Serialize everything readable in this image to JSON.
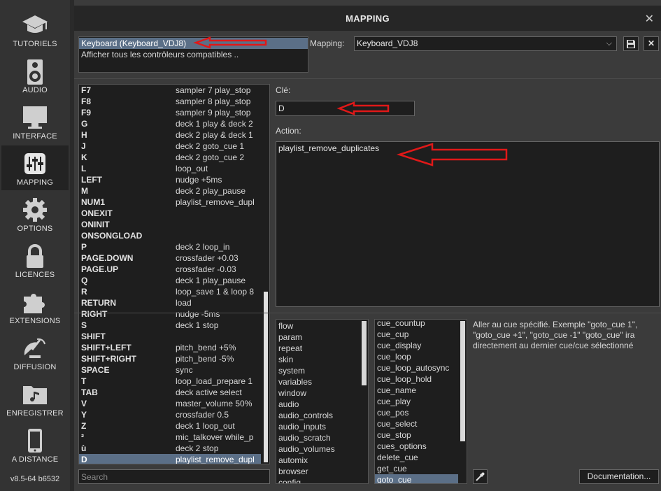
{
  "sidebar": {
    "items": [
      {
        "label": "TUTORIELS",
        "icon": "graduation-cap-icon"
      },
      {
        "label": "AUDIO",
        "icon": "speaker-icon"
      },
      {
        "label": "INTERFACE",
        "icon": "monitor-icon"
      },
      {
        "label": "MAPPING",
        "icon": "sliders-icon",
        "active": true
      },
      {
        "label": "OPTIONS",
        "icon": "gear-icon"
      },
      {
        "label": "LICENCES",
        "icon": "lock-icon"
      },
      {
        "label": "EXTENSIONS",
        "icon": "puzzle-icon"
      },
      {
        "label": "DIFFUSION",
        "icon": "broadcast-icon"
      },
      {
        "label": "ENREGISTRER",
        "icon": "music-folder-icon"
      },
      {
        "label": "A DISTANCE",
        "icon": "tablet-icon"
      }
    ],
    "version": "v8.5-64 b6532"
  },
  "dialog": {
    "title": "MAPPING",
    "close_icon": "close-icon"
  },
  "devices": {
    "items": [
      {
        "label": "Keyboard (Keyboard_VDJ8)",
        "selected": true
      },
      {
        "label": "Afficher tous les contrôleurs compatibles ..",
        "selected": false
      }
    ]
  },
  "mapping": {
    "label": "Mapping:",
    "value": "Keyboard_VDJ8",
    "save_icon": "floppy-disk-icon",
    "delete_label": "✕"
  },
  "keylist": {
    "rows": [
      {
        "key": "F7",
        "action": "sampler 7 play_stop"
      },
      {
        "key": "F8",
        "action": "sampler 8 play_stop"
      },
      {
        "key": "F9",
        "action": "sampler 9 play_stop"
      },
      {
        "key": "G",
        "action": "deck 1 play & deck 2"
      },
      {
        "key": "H",
        "action": "deck 2 play & deck 1"
      },
      {
        "key": "J",
        "action": "deck 2 goto_cue 1"
      },
      {
        "key": "K",
        "action": "deck 2 goto_cue 2"
      },
      {
        "key": "L",
        "action": "loop_out"
      },
      {
        "key": "LEFT",
        "action": "nudge +5ms"
      },
      {
        "key": "M",
        "action": "deck 2 play_pause"
      },
      {
        "key": "NUM1",
        "action": "playlist_remove_dupl"
      },
      {
        "key": "ONEXIT",
        "action": ""
      },
      {
        "key": "ONINIT",
        "action": ""
      },
      {
        "key": "ONSONGLOAD",
        "action": ""
      },
      {
        "key": "P",
        "action": "deck 2 loop_in"
      },
      {
        "key": "PAGE.DOWN",
        "action": "crossfader +0.03"
      },
      {
        "key": "PAGE.UP",
        "action": "crossfader -0.03"
      },
      {
        "key": "Q",
        "action": "deck 1 play_pause"
      },
      {
        "key": "R",
        "action": "loop_save 1 & loop 8"
      },
      {
        "key": "RETURN",
        "action": "load"
      },
      {
        "key": "RIGHT",
        "action": "nudge -5ms"
      },
      {
        "key": "S",
        "action": "deck 1 stop"
      },
      {
        "key": "SHIFT",
        "action": ""
      },
      {
        "key": "SHIFT+LEFT",
        "action": "pitch_bend +5%"
      },
      {
        "key": "SHIFT+RIGHT",
        "action": "pitch_bend -5%"
      },
      {
        "key": "SPACE",
        "action": "sync"
      },
      {
        "key": "T",
        "action": "loop_load_prepare 1"
      },
      {
        "key": "TAB",
        "action": "deck active select"
      },
      {
        "key": "V",
        "action": "master_volume 50%"
      },
      {
        "key": "Y",
        "action": "crossfader 0.5"
      },
      {
        "key": "Z",
        "action": "deck 1 loop_out"
      },
      {
        "key": "²",
        "action": "mic_talkover while_p"
      },
      {
        "key": "ù",
        "action": "deck 2 stop"
      },
      {
        "key": "D",
        "action": "playlist_remove_dupl",
        "selected": true
      }
    ]
  },
  "search": {
    "placeholder": "Search"
  },
  "key_editor": {
    "key_label": "Clé:",
    "key_value": "D",
    "action_label": "Action:",
    "action_value": "playlist_remove_duplicates"
  },
  "categories": [
    "flow",
    "param",
    "repeat",
    "skin",
    "system",
    "variables",
    "window",
    "audio",
    "audio_controls",
    "audio_inputs",
    "audio_scratch",
    "audio_volumes",
    "automix",
    "browser",
    "config"
  ],
  "verbs": [
    {
      "label": "cue_countup"
    },
    {
      "label": "cue_cup"
    },
    {
      "label": "cue_display"
    },
    {
      "label": "cue_loop"
    },
    {
      "label": "cue_loop_autosync"
    },
    {
      "label": "cue_loop_hold"
    },
    {
      "label": "cue_name"
    },
    {
      "label": "cue_play"
    },
    {
      "label": "cue_pos"
    },
    {
      "label": "cue_select"
    },
    {
      "label": "cue_stop"
    },
    {
      "label": "cues_options"
    },
    {
      "label": "delete_cue"
    },
    {
      "label": "get_cue"
    },
    {
      "label": "goto_cue",
      "selected": true
    }
  ],
  "description": "Aller au cue spécifié. Exemple \"goto_cue 1\", \"goto_cue +1\", \"goto_cue -1\" \"goto_cue\" ira directement au dernier cue/cue sélectionné",
  "footer": {
    "pipette_icon": "eyedropper-icon",
    "documentation_label": "Documentation..."
  },
  "colors": {
    "selection": "#5b6f87",
    "annotation_arrow": "#e01818",
    "panel_bg": "#1e1e1e"
  }
}
